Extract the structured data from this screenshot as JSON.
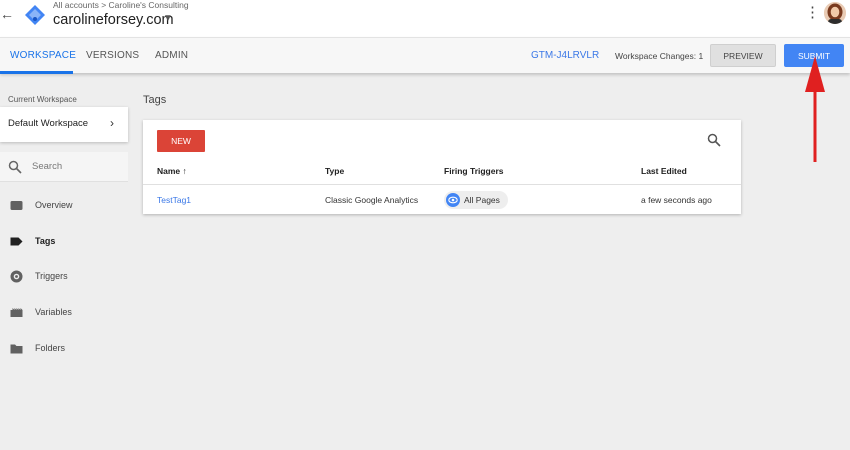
{
  "header": {
    "breadcrumb": "All accounts > Caroline's Consulting",
    "account_name": "carolineforsey.com",
    "icons": {
      "back": "back-arrow-icon",
      "logo": "gtm-logo-icon",
      "caret": "caret-down-icon",
      "more": "more-vert-icon"
    }
  },
  "nav": {
    "tabs": [
      {
        "label": "WORKSPACE",
        "active": true
      },
      {
        "label": "VERSIONS",
        "active": false
      },
      {
        "label": "ADMIN",
        "active": false
      }
    ],
    "container_id": "GTM-J4LRVLR",
    "workspace_changes_label": "Workspace Changes:",
    "workspace_changes_count": "1",
    "preview_label": "PREVIEW",
    "submit_label": "SUBMIT"
  },
  "sidebar": {
    "current_workspace_label": "Current Workspace",
    "workspace_name": "Default Workspace",
    "search_placeholder": "Search",
    "items": [
      {
        "label": "Overview",
        "icon": "overview-icon",
        "active": false
      },
      {
        "label": "Tags",
        "icon": "tag-icon",
        "active": true
      },
      {
        "label": "Triggers",
        "icon": "trigger-icon",
        "active": false
      },
      {
        "label": "Variables",
        "icon": "variables-icon",
        "active": false
      },
      {
        "label": "Folders",
        "icon": "folder-icon",
        "active": false
      }
    ]
  },
  "main": {
    "title": "Tags",
    "new_label": "NEW",
    "columns": [
      "Name",
      "Type",
      "Firing Triggers",
      "Last Edited"
    ],
    "sort_indicator": "↑",
    "rows": [
      {
        "name": "TestTag1",
        "type": "Classic Google Analytics",
        "trigger": "All Pages",
        "last_edited": "a few seconds ago"
      }
    ]
  },
  "colors": {
    "accent": "#1a73e8",
    "submit": "#4285f4",
    "new_button": "#db4437",
    "annotation_arrow": "#e02020"
  }
}
